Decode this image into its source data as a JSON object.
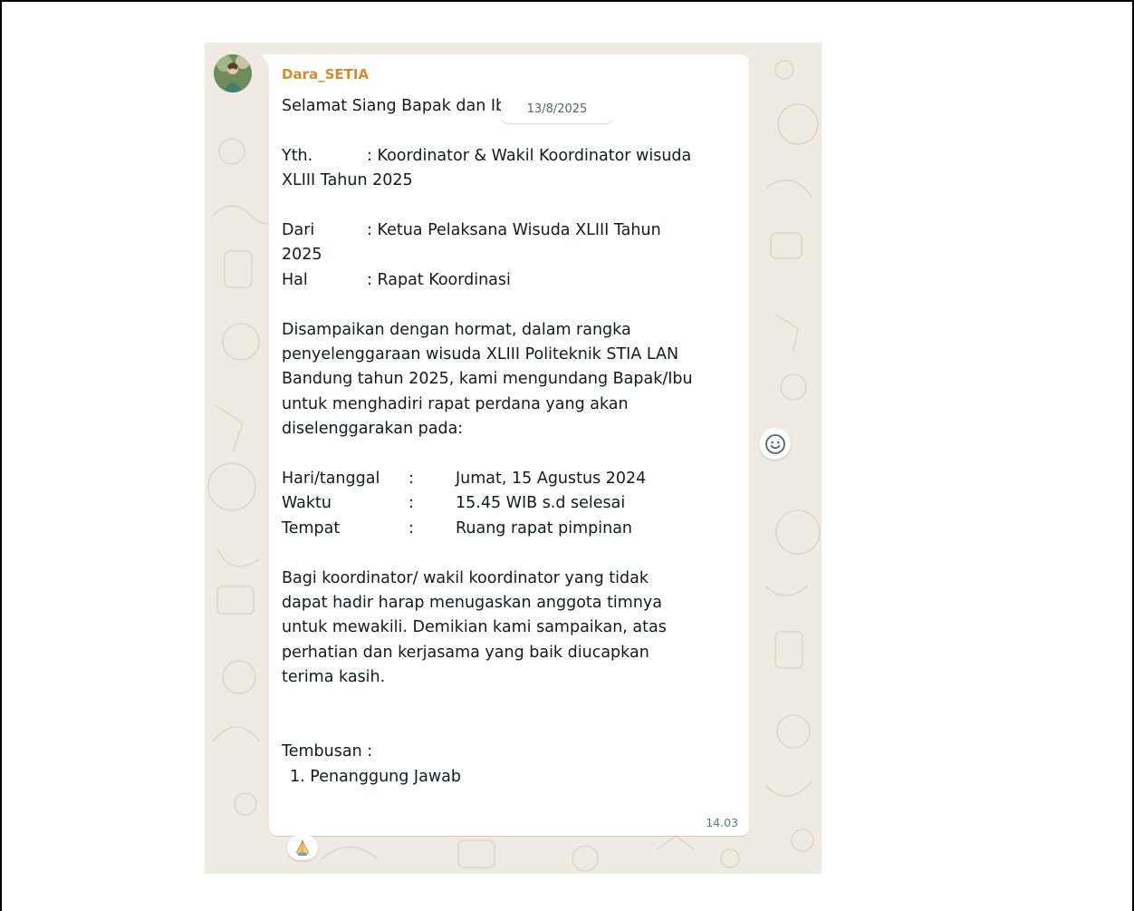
{
  "chat": {
    "date_separator": "13/8/2025",
    "message": {
      "sender": "Dara_SETIA",
      "time": "14.03",
      "reaction_emoji": "🙏",
      "greeting": "Selamat Siang Bapak dan Ibu.",
      "header_fields": {
        "yth_label": "Yth.",
        "yth_value_line1": ": Koordinator & Wakil Koordinator wisuda",
        "yth_value_line2": "XLIII Tahun 2025",
        "dari_label": "Dari",
        "dari_value_line1": ": Ketua Pelaksana Wisuda XLIII Tahun",
        "dari_value_line2": "2025",
        "hal_label": "Hal",
        "hal_value": ": Rapat Koordinasi"
      },
      "intro_lines": [
        "Disampaikan dengan hormat, dalam rangka",
        "penyelenggaraan wisuda XLIII Politeknik STIA LAN",
        "Bandung tahun 2025, kami mengundang Bapak/Ibu",
        "untuk menghadiri rapat perdana yang akan",
        "diselenggarakan pada:"
      ],
      "schedule": {
        "separator": ":",
        "rows": [
          {
            "label": "Hari/tanggal",
            "value": "Jumat, 15 Agustus 2024"
          },
          {
            "label": "Waktu",
            "value": "15.45 WIB s.d selesai"
          },
          {
            "label": "Tempat",
            "value": "Ruang rapat pimpinan"
          }
        ]
      },
      "closing_lines": [
        "Bagi koordinator/ wakil koordinator yang tidak",
        "dapat hadir harap menugaskan anggota timnya",
        "untuk mewakili. Demikian kami sampaikan, atas",
        "perhatian dan kerjasama yang baik diucapkan",
        "terima kasih."
      ],
      "cc_label": "Tembusan :",
      "cc_items": [
        "1. Penanggung Jawab"
      ]
    }
  },
  "icons": {
    "avatar": "avatar-photo",
    "emoji_reaction_button": "smiley-icon",
    "reaction": "folded-hands-emoji"
  },
  "colors": {
    "wallpaper": "#efeae2",
    "bubble": "#ffffff",
    "sender_name": "#d08c2e",
    "text": "#111b21",
    "meta": "#667781"
  }
}
